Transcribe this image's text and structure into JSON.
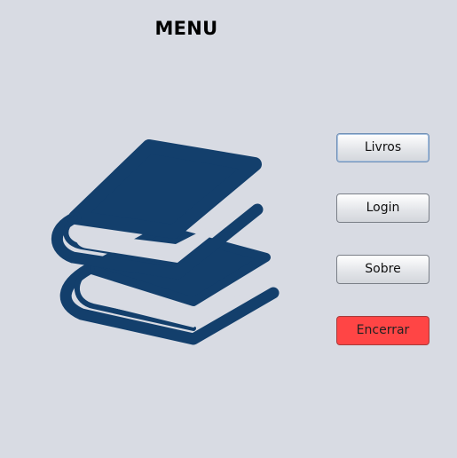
{
  "window": {
    "title": "MENU"
  },
  "logo": {
    "icon": "books-icon",
    "color": "#133f6c"
  },
  "menu": {
    "buttons": [
      {
        "label": "Livros"
      },
      {
        "label": "Login"
      },
      {
        "label": "Sobre"
      },
      {
        "label": "Encerrar",
        "color": "#ff4545"
      }
    ]
  }
}
